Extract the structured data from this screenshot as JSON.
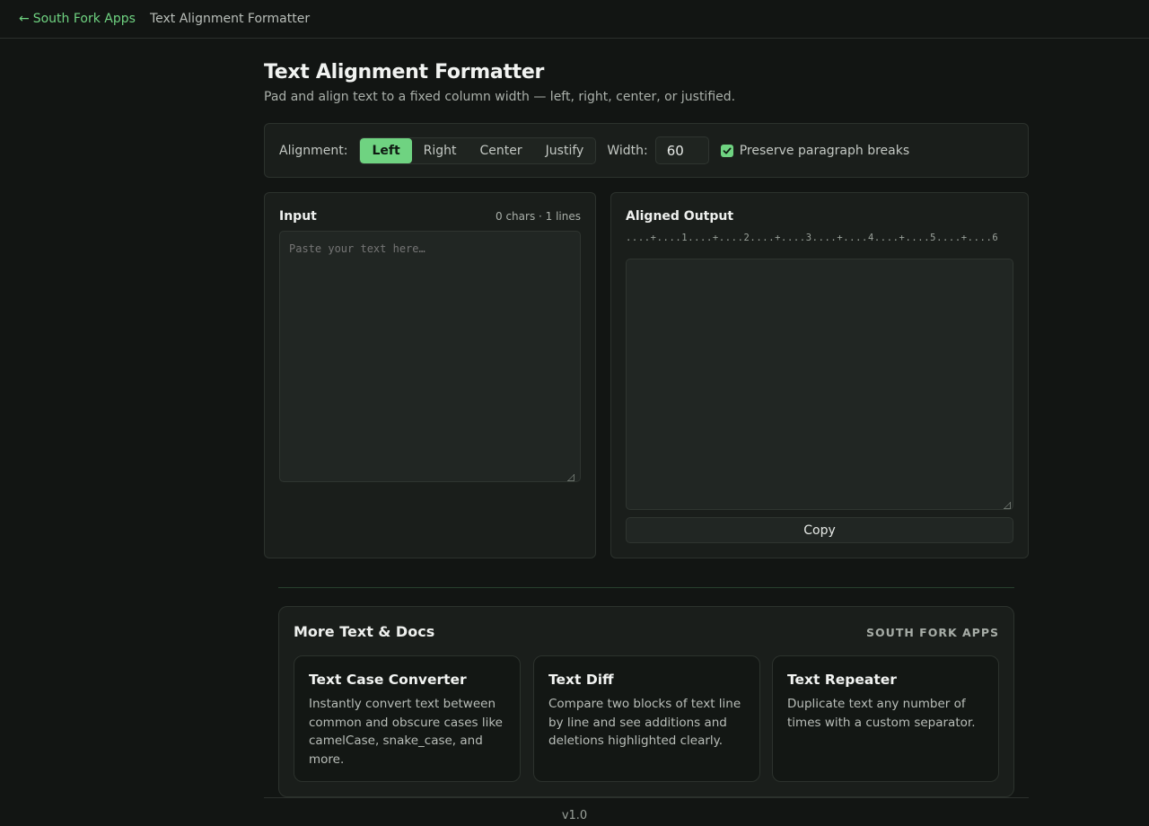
{
  "topbar": {
    "back_arrow": "←",
    "back_label": "South Fork Apps",
    "current": "Text Alignment Formatter"
  },
  "header": {
    "title": "Text Alignment Formatter",
    "subtitle": "Pad and align text to a fixed column width — left, right, center, or justified."
  },
  "toolbar": {
    "alignment_label": "Alignment:",
    "alignments": [
      "Left",
      "Right",
      "Center",
      "Justify"
    ],
    "selected_alignment": "Left",
    "width_label": "Width:",
    "width_value": "60",
    "preserve_label": "Preserve paragraph breaks",
    "preserve_checked": true
  },
  "input_panel": {
    "title": "Input",
    "meta": "0 chars · 1 lines",
    "placeholder": "Paste your text here…"
  },
  "output_panel": {
    "title": "Aligned Output",
    "ruler": "....+....1....+....2....+....3....+....4....+....5....+....6",
    "copy_label": "Copy"
  },
  "more": {
    "title": "More Text & Docs",
    "brand": "SOUTH FORK APPS",
    "cards": [
      {
        "title": "Text Case Converter",
        "description": "Instantly convert text between common and obscure cases like camelCase, snake_case, and more."
      },
      {
        "title": "Text Diff",
        "description": "Compare two blocks of text line by line and see additions and deletions highlighted clearly."
      },
      {
        "title": "Text Repeater",
        "description": "Duplicate text any number of times with a custom separator."
      }
    ]
  },
  "footer": {
    "version": "v1.0"
  },
  "colors": {
    "accent": "#6fd381",
    "background": "#121513",
    "panel": "#1a1e1b"
  }
}
